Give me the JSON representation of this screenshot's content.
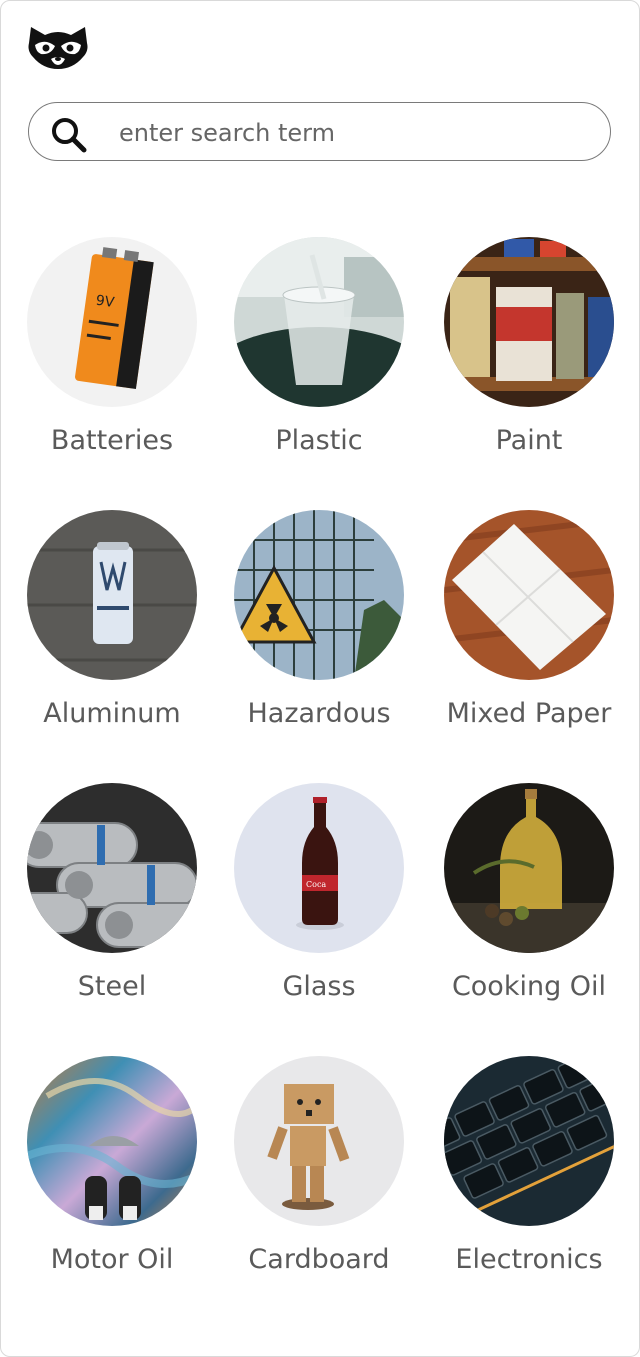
{
  "header": {
    "logo_icon": "raccoon-icon"
  },
  "search": {
    "placeholder": "enter search term",
    "value": "",
    "icon": "search-icon"
  },
  "categories": [
    {
      "label": "Batteries"
    },
    {
      "label": "Plastic"
    },
    {
      "label": "Paint"
    },
    {
      "label": "Aluminum"
    },
    {
      "label": "Hazardous"
    },
    {
      "label": "Mixed Paper"
    },
    {
      "label": "Steel"
    },
    {
      "label": "Glass"
    },
    {
      "label": "Cooking Oil"
    },
    {
      "label": "Motor Oil"
    },
    {
      "label": "Cardboard"
    },
    {
      "label": "Electronics"
    }
  ]
}
